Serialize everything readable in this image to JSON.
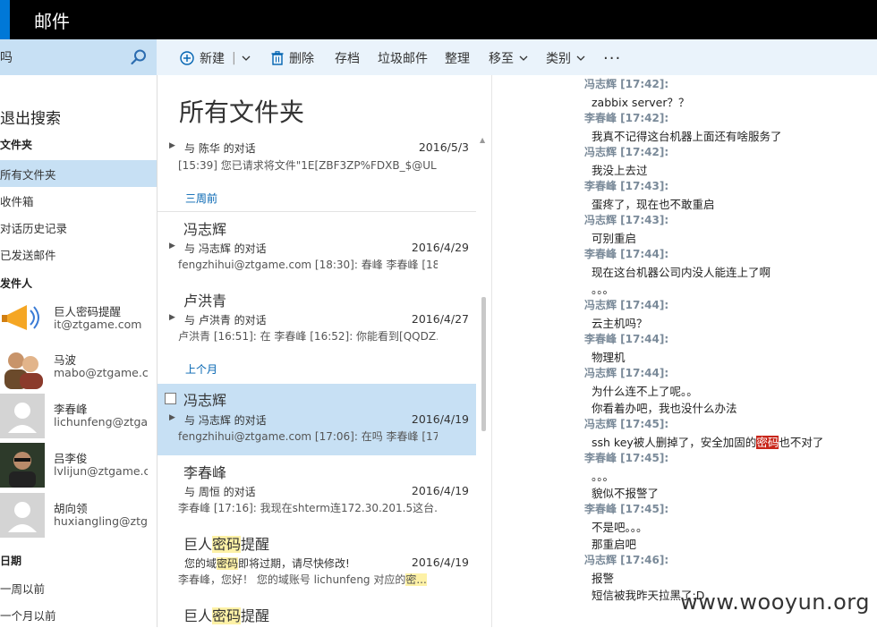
{
  "app": {
    "title": "邮件"
  },
  "search": {
    "query": "吗"
  },
  "toolbar": {
    "new_label": "新建",
    "delete_label": "删除",
    "archive_label": "存档",
    "junk_label": "垃圾邮件",
    "sweep_label": "整理",
    "move_label": "移至",
    "category_label": "类别",
    "more_label": "..."
  },
  "leftpane": {
    "exit_search": "退出搜索",
    "folders_header": "文件夹",
    "folders": [
      "所有文件夹",
      "收件箱",
      "对话历史记录",
      "已发送邮件"
    ],
    "senders_header": "发件人",
    "senders": [
      {
        "name": "巨人密码提醒",
        "email": "it@ztgame.com"
      },
      {
        "name": "马波",
        "email": "mabo@ztgame.com"
      },
      {
        "name": "李春峰",
        "email": "lichunfeng@ztgame.com"
      },
      {
        "name": "吕李俊",
        "email": "lvlijun@ztgame.com"
      },
      {
        "name": "胡向领",
        "email": "huxiangling@ztgame.com"
      }
    ],
    "date_header": "日期",
    "date_filters": [
      "一周以前",
      "一个月以前"
    ]
  },
  "midpane": {
    "title": "所有文件夹",
    "top_item": {
      "conv": "与 陈华 的对话",
      "date": "2016/5/3",
      "preview": "[15:39] 您已请求将文件\"1E[ZBF3ZP%FDXB_$@UL..."
    },
    "group1": "三周前",
    "group2": "上个月",
    "messages": [
      {
        "sender": "冯志辉",
        "conv": "与 冯志辉 的对话",
        "date": "2016/4/29",
        "preview": "fengzhihui@ztgame.com [18:30]: 春峰 李春峰 [18..."
      },
      {
        "sender": "卢洪青",
        "conv": "与 卢洪青 的对话",
        "date": "2016/4/27",
        "preview": "卢洪青 [16:51]: 在 李春峰 [16:52]: 你能看到[QQDZ..."
      },
      {
        "sender": "冯志辉",
        "conv": "与 冯志辉 的对话",
        "date": "2016/4/19",
        "preview": "fengzhihui@ztgame.com [17:06]: 在吗 李春峰 [17..."
      },
      {
        "sender": "李春峰",
        "conv": "与 周恒 的对话",
        "date": "2016/4/19",
        "preview": "李春峰 [17:16]: 我现在shterm连172.30.201.5这台..."
      }
    ],
    "pw_item": {
      "sender_pre": "巨人",
      "sender_hl": "密码",
      "sender_post": "提醒",
      "line1_pre": "您的域",
      "line1_hl": "密码",
      "line1_post": "即将过期，请尽快修改!",
      "date": "2016/4/19",
      "line2_pre": "李春峰，您好！ 您的域账号 lichunfeng 对应的",
      "line2_hl": "密..."
    },
    "pw_item2": {
      "sender_pre": "巨人",
      "sender_hl": "密码",
      "sender_post": "提醒"
    }
  },
  "chat": [
    {
      "speaker": "冯志辉 [17:42]:",
      "text": "zabbix server？？"
    },
    {
      "speaker": "李春峰 [17:42]:",
      "text": "我真不记得这台机器上面还有啥服务了"
    },
    {
      "speaker": "冯志辉 [17:42]:",
      "text": "我没上去过"
    },
    {
      "speaker": "李春峰 [17:43]:",
      "text": "蛋疼了，现在也不敢重启"
    },
    {
      "speaker": "冯志辉 [17:43]:",
      "text": "可别重启"
    },
    {
      "speaker": "李春峰 [17:44]:",
      "text": "现在这台机器公司内没人能连上了啊",
      "text2": "。。。"
    },
    {
      "speaker": "冯志辉 [17:44]:",
      "text": "云主机吗？"
    },
    {
      "speaker": "李春峰 [17:44]:",
      "text": "物理机"
    },
    {
      "speaker": "冯志辉 [17:44]:",
      "text": "为什么连不上了呢。。",
      "text2": "你看着办吧，我也没什么办法"
    },
    {
      "speaker": "冯志辉 [17:45]:",
      "text_pre": "ssh key被人删掉了，安全加固的",
      "text_hl": "密码",
      "text_post": "也不对了"
    },
    {
      "speaker": "李春峰 [17:45]:",
      "text": "。。。",
      "text2": "貌似不报警了"
    },
    {
      "speaker": "李春峰 [17:45]:",
      "text": "不是吧。。。",
      "text2": "那重启吧"
    },
    {
      "speaker": "冯志辉 [17:46]:",
      "text": "报警",
      "text2": "短信被我昨天拉黑了:D"
    }
  ],
  "watermark": "www.wooyun.org",
  "colors": {
    "accent": "#0078d7",
    "selection": "#c7e0f4",
    "toolbar": "#eaf3fb",
    "highlight": "#fdf1a6",
    "redhighlight": "#c8261a"
  }
}
